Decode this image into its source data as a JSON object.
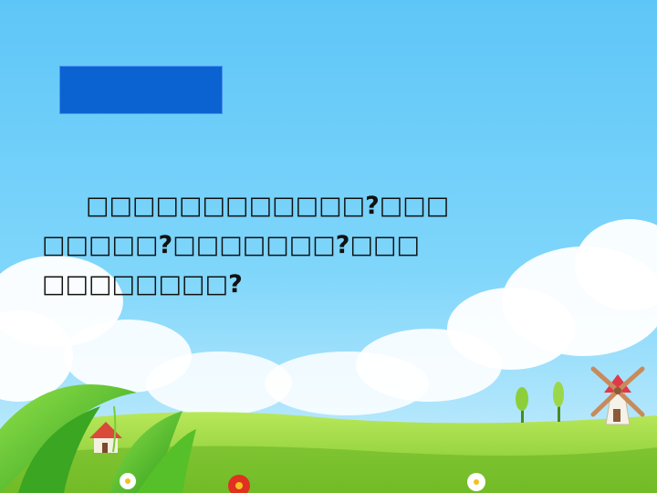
{
  "slide": {
    "title_box_color": "#0a63d0",
    "text_lines": [
      "□□□□□□□□□□□□?□□□",
      "□□□□□?□□□□□□□?□□□",
      "□□□□□□□□?"
    ]
  },
  "scene": {
    "sky_top": "#5ec6f7",
    "sky_bottom": "#bdeaff",
    "grass_color": "#8cd13a",
    "icons": [
      "cloud-icon",
      "windmill-icon",
      "house-icon",
      "leaf-icon",
      "flower-icon",
      "tree-icon"
    ]
  }
}
